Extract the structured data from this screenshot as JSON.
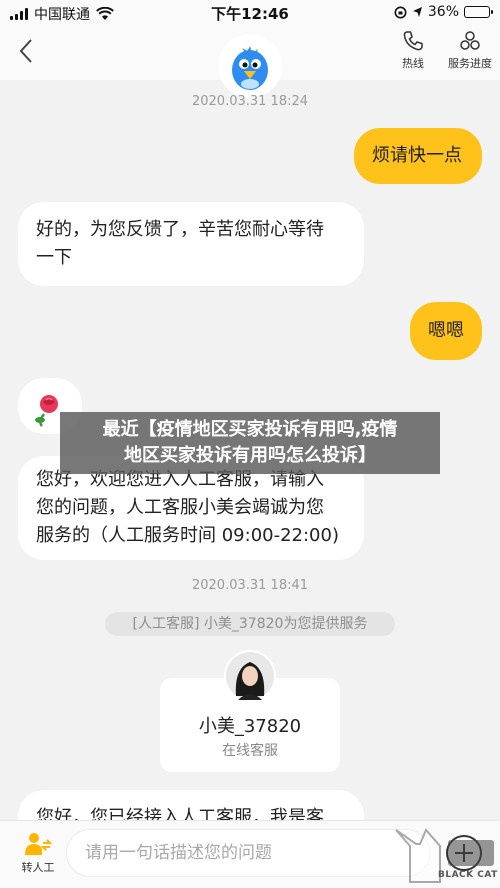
{
  "status_bar": {
    "carrier": "中国联通",
    "time": "下午12:46",
    "battery": "36%",
    "battery_level": 0.36
  },
  "header": {
    "hotline_label": "热线",
    "service_progress_label": "服务进度"
  },
  "messages": {
    "timestamp_1": "2020.03.31 18:24",
    "user_1": "烦请快一点",
    "bot_1_line1": "好的，为您反馈了，辛苦您耐心等待",
    "bot_1_line2": "一下",
    "user_2": "嗯嗯",
    "bot_2_line1": "您好，欢迎您进入人工客服，请输入",
    "bot_2_line2": "您的问题，人工客服小美会竭诚为您",
    "bot_2_line3": "服务的（人工服务时间 09:00-22:00)",
    "timestamp_2": "2020.03.31 18:41",
    "system_notice": "[人工客服] 小美_37820为您提供服务",
    "agent_name": "小美_37820",
    "agent_status": "在线客服",
    "partial_message": "您好，您已经接入人工客服，我是客"
  },
  "banner": {
    "line1": "最近【疫情地区买家投诉有用吗,疫情",
    "line2": "地区买家投诉有用吗怎么投诉】"
  },
  "bottom_bar": {
    "transfer_label": "转人工",
    "input_placeholder": "请用一句话描述您的问题"
  },
  "watermark": {
    "text": "BLACK CAT"
  },
  "colors": {
    "accent_yellow": "#ffc21a",
    "background": "#f2f2f2"
  }
}
